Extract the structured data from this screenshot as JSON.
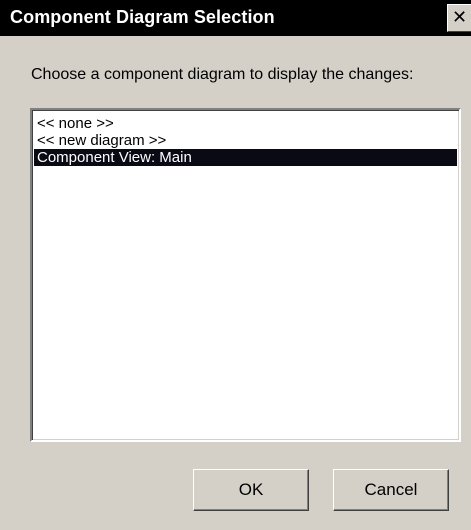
{
  "window": {
    "title": "Component Diagram Selection",
    "close_glyph": "✕"
  },
  "prompt": "Choose a component diagram to display the changes:",
  "list": {
    "items": [
      {
        "label": "<< none >>",
        "selected": false
      },
      {
        "label": "<< new diagram >>",
        "selected": false
      },
      {
        "label": "Component View: Main",
        "selected": true
      }
    ]
  },
  "buttons": {
    "ok_label": "OK",
    "cancel_label": "Cancel"
  },
  "colors": {
    "titlebar": "#000000",
    "dialog_bg": "#d4d0c8",
    "selection": "#0a0a14"
  }
}
